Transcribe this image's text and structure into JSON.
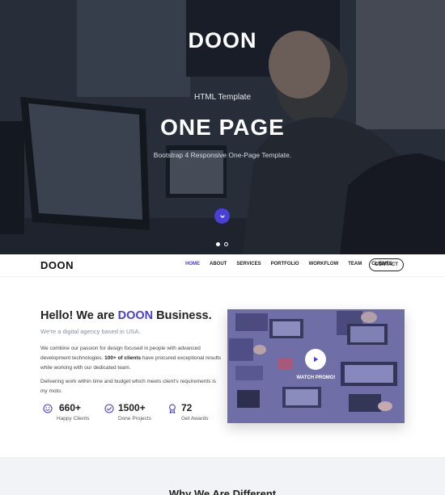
{
  "hero": {
    "logo": "DOON",
    "kicker": "HTML Template",
    "title": "ONE PAGE",
    "subtitle": "Bootstrap 4 Responsive One-Page Template.",
    "down_icon": "chevron-down-icon",
    "slider_dots": [
      "active",
      "inactive"
    ]
  },
  "nav": {
    "logo": "DOON",
    "links": [
      "HOME",
      "ABOUT",
      "SERVICES",
      "PORTFOLIO",
      "WORKFLOW",
      "TEAM",
      "CLIENTS"
    ],
    "active": "HOME",
    "contact_label": "CONTACT"
  },
  "about": {
    "title_prefix": "Hello! We are ",
    "title_brand": "DOON",
    "title_suffix": " Business.",
    "tagline": "We're a digital agency based in USA.",
    "p1_a": "We combine our passion for design focused in people with advanced development technologies. ",
    "p1_bold": "100+ of clients",
    "p1_b": " have procured exceptional results while working with our dedicated team.",
    "p2": "Delivering work within time and budget which meets client's requirements is my moto.",
    "stats": [
      {
        "icon": "smile-icon",
        "value": "660+",
        "label": "Happy Clients"
      },
      {
        "icon": "check-circle-icon",
        "value": "1500+",
        "label": "Done Projects"
      },
      {
        "icon": "award-icon",
        "value": "72",
        "label": "Get Awards"
      }
    ]
  },
  "video": {
    "play_icon": "play-icon",
    "label": "WATCH PROMO!"
  },
  "next_section": {
    "title": "Why We Are Different"
  },
  "colors": {
    "accent": "#4a3fd6",
    "text_dark": "#222222",
    "muted": "#8a8fa0",
    "section_bg": "#f2f3f7"
  }
}
